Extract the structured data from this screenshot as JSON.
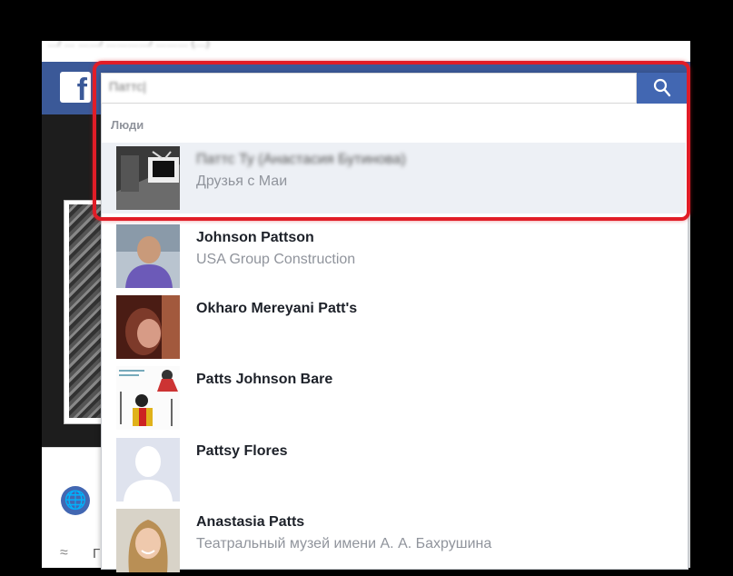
{
  "browser": {
    "url_text": "…/ … ……/ …………/ ……… (…)"
  },
  "facebook": {
    "logo_letter": "f",
    "side_letter": "Г"
  },
  "search": {
    "value": "Паттс|",
    "button_label": ""
  },
  "dropdown": {
    "section_label": "Люди",
    "results": [
      {
        "name": "Паттс Ту (Анастасия Бутинова)",
        "subtitle": "Друзья с Маи",
        "highlighted": true
      },
      {
        "name": "Johnson Pattson",
        "subtitle": "USA Group Construction",
        "highlighted": false
      },
      {
        "name": "Okharo Mereyani Patt's",
        "subtitle": "",
        "highlighted": false
      },
      {
        "name": "Patts Johnson Bare",
        "subtitle": "",
        "highlighted": false
      },
      {
        "name": "Pattsy Flores",
        "subtitle": "",
        "highlighted": false
      },
      {
        "name": "Anastasia Patts",
        "subtitle": "Театральный музей имени А. А. Бахрушина",
        "highlighted": false
      }
    ]
  },
  "colors": {
    "facebook_blue": "#3b5998",
    "search_button": "#4267b2",
    "highlight_red": "#e11d27"
  }
}
